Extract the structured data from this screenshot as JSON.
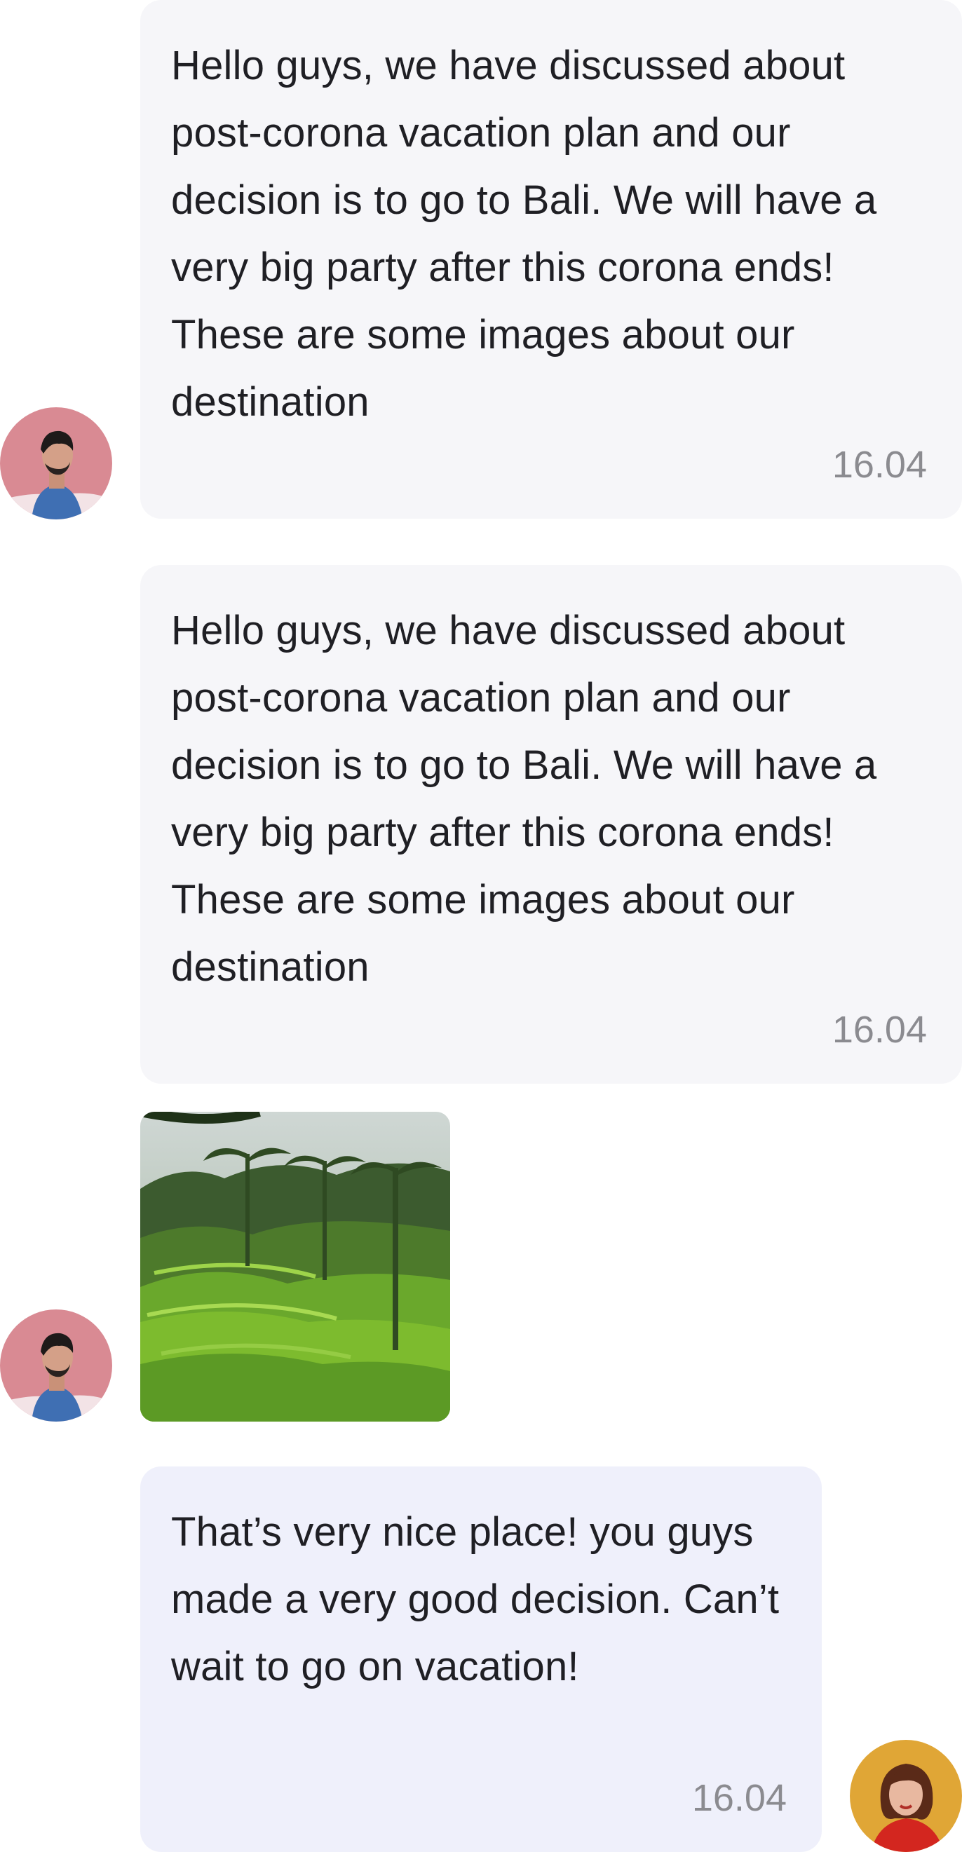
{
  "messages": [
    {
      "sender": "incoming",
      "text": "Hello guys, we have discussed about post-corona vacation plan and our decision is to go to Bali. We will have a very big party after this corona ends! These are some images about our destination",
      "time": "16.04"
    },
    {
      "sender": "incoming",
      "text": "Hello guys, we have discussed about post-corona vacation plan and our decision is to go to Bali. We will have a very big party after this corona ends! These are some images about our destination",
      "time": "16.04"
    },
    {
      "sender": "incoming",
      "type": "image",
      "image": "rice-terrace-photo"
    },
    {
      "sender": "outgoing",
      "text": "That’s very nice place! you guys made a very good decision. Can’t wait to go on vacation!",
      "time": "16.04"
    }
  ],
  "colors": {
    "incoming_bubble": "#f6f6f9",
    "outgoing_bubble": "#eff0fb",
    "text": "#1f1f24",
    "time": "#8b8b90",
    "avatar_man_bg": "#d98a93",
    "avatar_woman_bg": "#e0a636"
  }
}
